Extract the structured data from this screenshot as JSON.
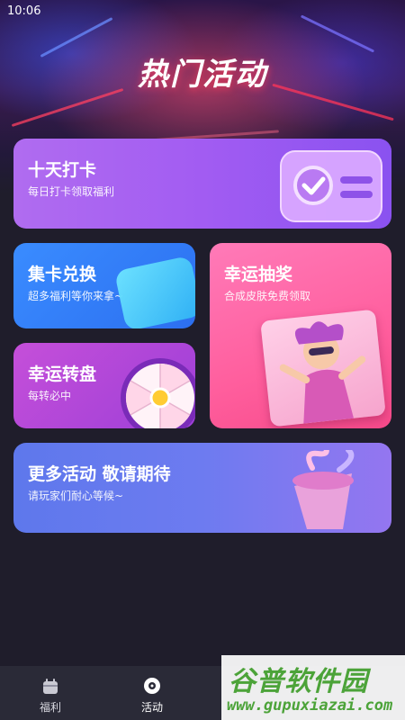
{
  "status_bar": {
    "time": "10:06"
  },
  "header": {
    "title": "热门活动"
  },
  "cards": {
    "checkin": {
      "title": "十天打卡",
      "subtitle": "每日打卡领取福利"
    },
    "collect": {
      "title": "集卡兑换",
      "subtitle": "超多福利等你来拿~"
    },
    "lottery": {
      "title": "幸运抽奖",
      "subtitle": "合成皮肤免费领取"
    },
    "wheel": {
      "title": "幸运转盘",
      "subtitle": "每转必中"
    },
    "more": {
      "title": "更多活动 敬请期待",
      "subtitle": "请玩家们耐心等候~"
    }
  },
  "tabbar": {
    "items": [
      {
        "label": "福利",
        "icon": "gift-bag-icon",
        "active": false
      },
      {
        "label": "活动",
        "icon": "activity-disc-icon",
        "active": true
      }
    ]
  },
  "watermark": {
    "logo_text": "谷普软件园",
    "url": "www.gupuxiazai.com"
  },
  "colors": {
    "background": "#1f1d2b",
    "tabbar": "#2a2a37",
    "checkin": "#a25cf2",
    "collect": "#2c6ff0",
    "lottery": "#ff5e9d",
    "wheel": "#9d3fd8",
    "more": "#6d7bf0",
    "watermark_green": "#4ca339"
  }
}
